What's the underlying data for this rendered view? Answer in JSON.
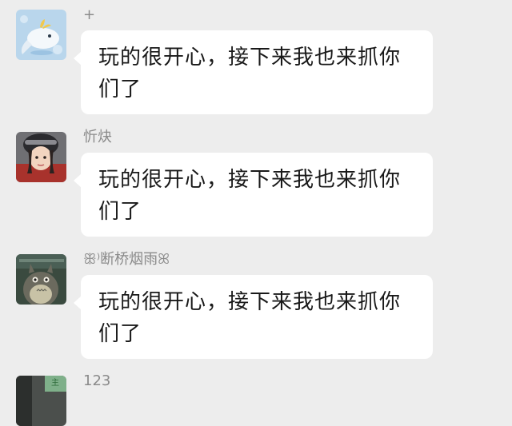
{
  "messages": [
    {
      "sender": "+",
      "text": "玩的很开心，接下来我也来抓你们了",
      "avatar": "whale-cartoon-avatar"
    },
    {
      "sender": "忻炔",
      "text": "玩的很开心，接下来我也来抓你们了",
      "avatar": "girl-helmet-avatar"
    },
    {
      "sender": "ꕥ⁾断桥烟雨ꕤ",
      "text": "玩的很开心，接下来我也来抓你们了",
      "avatar": "totoro-avatar"
    },
    {
      "sender": "123",
      "text": "",
      "avatar": "partial-avatar"
    }
  ],
  "colors": {
    "background": "#ededed",
    "bubble": "#ffffff",
    "sender_name": "#8a8a8a",
    "message_text": "#191919"
  }
}
